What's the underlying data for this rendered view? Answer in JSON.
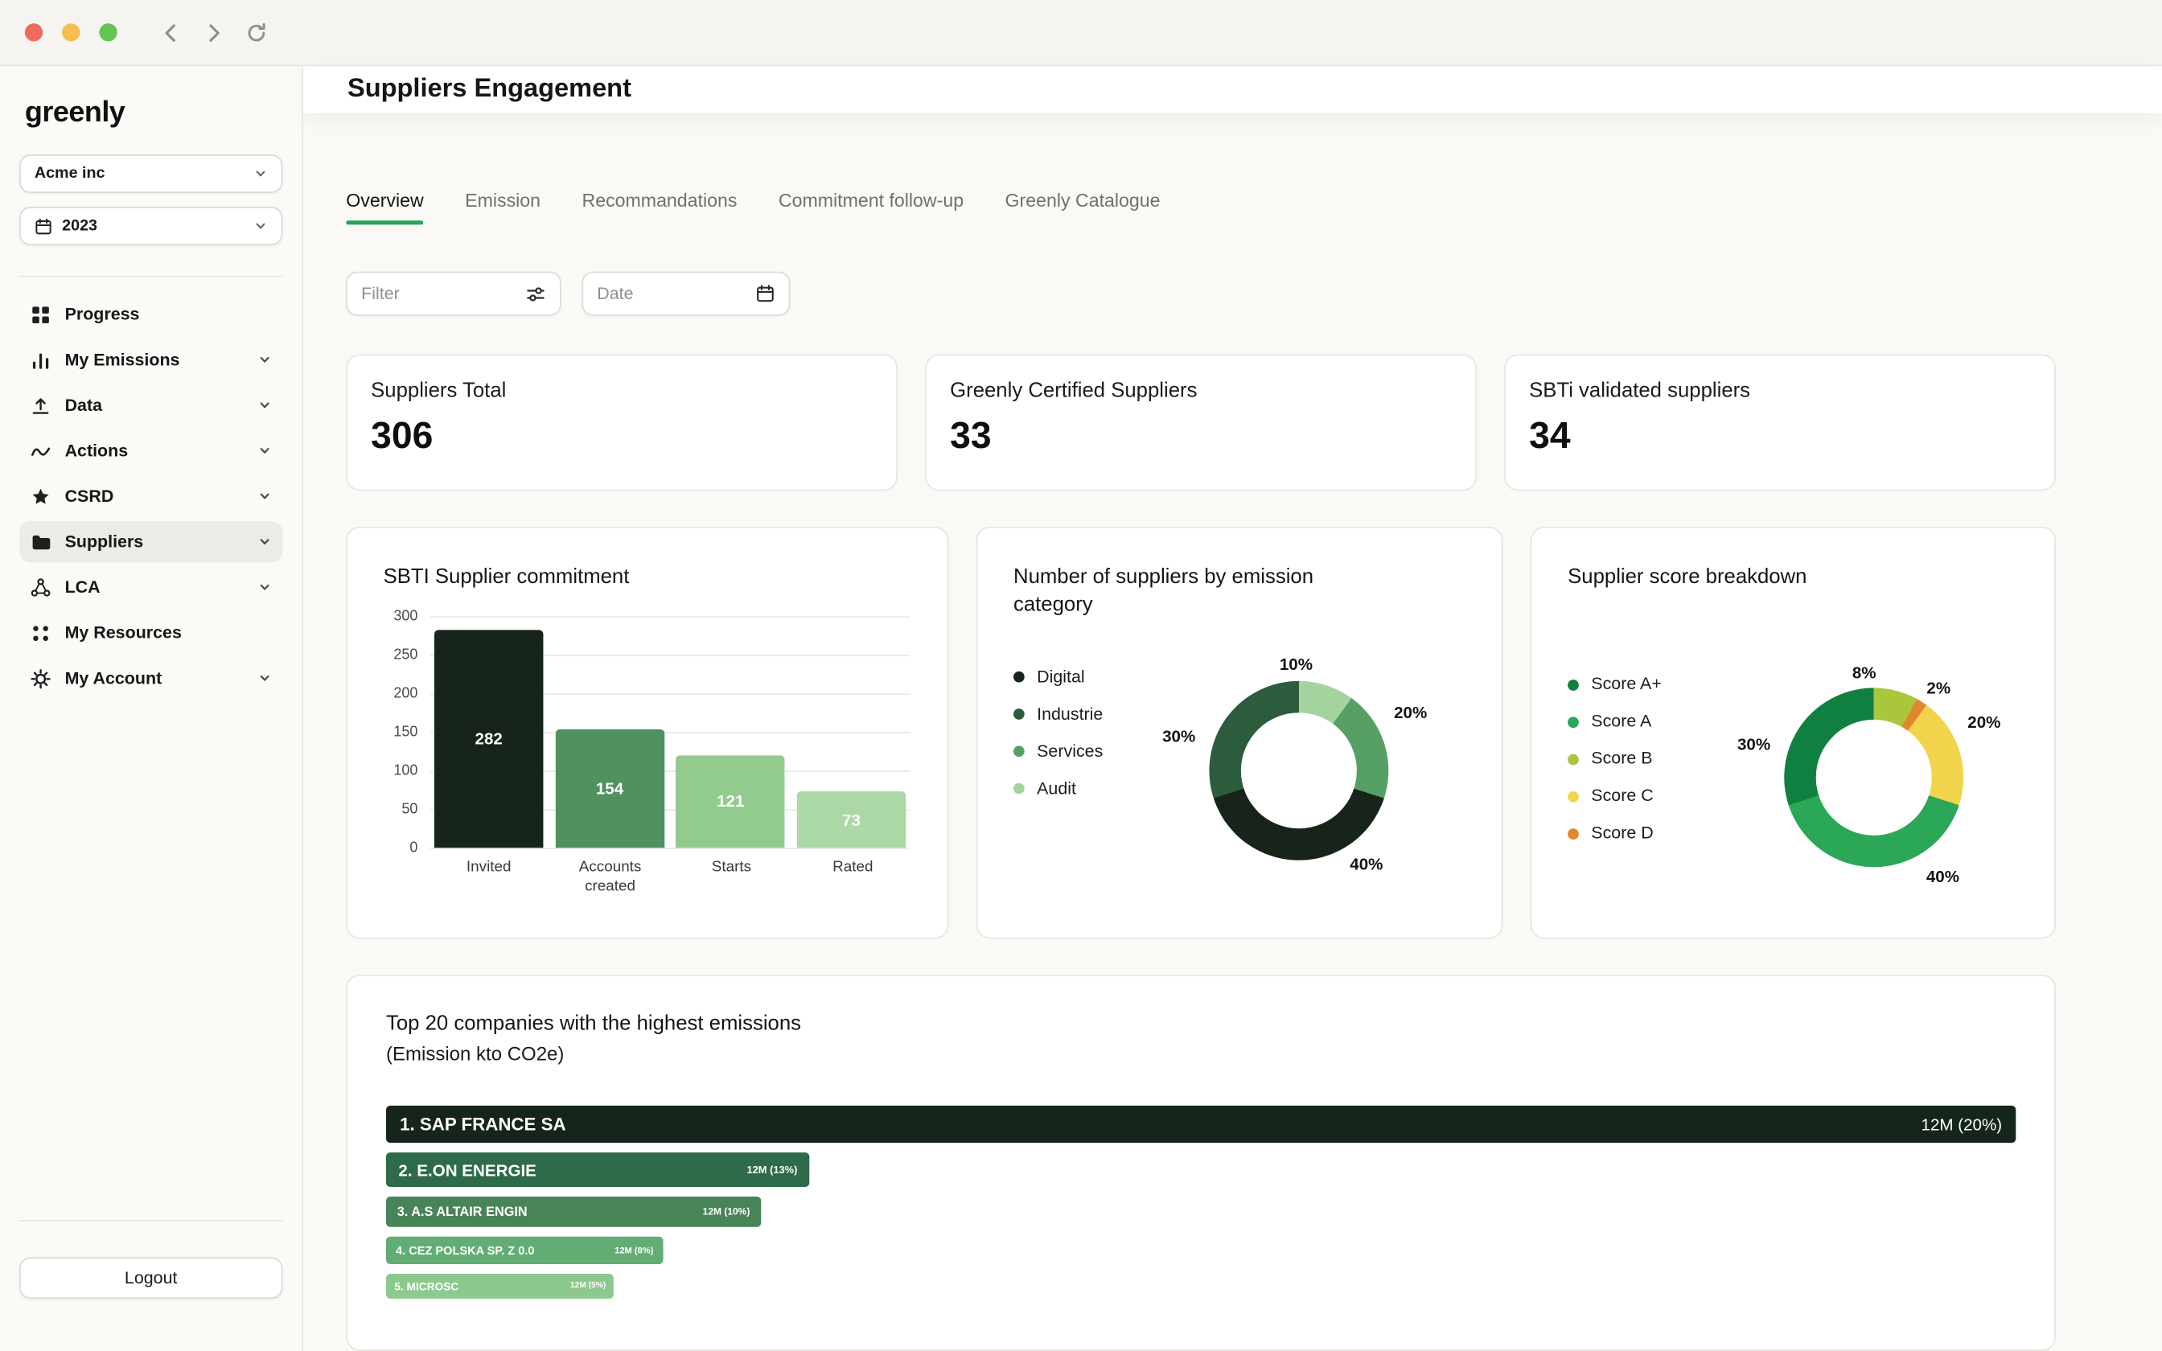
{
  "sidebar": {
    "logo": "greenly",
    "company": "Acme inc",
    "year": "2023",
    "items": [
      {
        "label": "Progress",
        "active": false
      },
      {
        "label": "My Emissions",
        "active": false
      },
      {
        "label": "Data",
        "active": false
      },
      {
        "label": "Actions",
        "active": false
      },
      {
        "label": "CSRD",
        "active": false
      },
      {
        "label": "Suppliers",
        "active": true
      },
      {
        "label": "LCA",
        "active": false
      },
      {
        "label": "My Resources",
        "active": false
      },
      {
        "label": "My Account",
        "active": false
      }
    ],
    "logout": "Logout"
  },
  "header": {
    "title": "Suppliers Engagement"
  },
  "tabs": [
    {
      "label": "Overview",
      "active": true
    },
    {
      "label": "Emission",
      "active": false
    },
    {
      "label": "Recommandations",
      "active": false
    },
    {
      "label": "Commitment follow-up",
      "active": false
    },
    {
      "label": "Greenly Catalogue",
      "active": false
    }
  ],
  "filters": {
    "filter_placeholder": "Filter",
    "date_placeholder": "Date"
  },
  "stats": [
    {
      "label": "Suppliers Total",
      "value": "306"
    },
    {
      "label": "Greenly Certified Suppliers",
      "value": "33"
    },
    {
      "label": "SBTi validated suppliers",
      "value": "34"
    }
  ],
  "chart_data": [
    {
      "id": "sbti-supplier-commitment",
      "type": "bar",
      "title": "SBTI Supplier commitment",
      "categories": [
        "Invited",
        "Accounts created",
        "Starts",
        "Rated"
      ],
      "values": [
        282,
        154,
        121,
        73
      ],
      "bar_colors": [
        "#16241b",
        "#4f9260",
        "#93ca8e",
        "#abd8a6"
      ],
      "ylim": [
        0,
        300
      ],
      "ytick_labels": [
        "300",
        "250",
        "200",
        "150",
        "100",
        "50",
        "0"
      ],
      "grid": true,
      "legend_position": "none"
    },
    {
      "id": "suppliers-by-emission-category",
      "type": "donut",
      "title": "Number of suppliers by emission category",
      "legend_position": "left",
      "legend": [
        {
          "label": "Digital",
          "color": "#182419"
        },
        {
          "label": "Industrie",
          "color": "#2b5d3d"
        },
        {
          "label": "Services",
          "color": "#56a065"
        },
        {
          "label": "Audit",
          "color": "#a5d3a0"
        }
      ],
      "segments": [
        {
          "label": "Audit",
          "pct": 10,
          "pct_label": "10%",
          "color": "#a5d3a0"
        },
        {
          "label": "Services",
          "pct": 20,
          "pct_label": "20%",
          "color": "#56a065"
        },
        {
          "label": "Digital",
          "pct": 40,
          "pct_label": "40%",
          "color": "#182419"
        },
        {
          "label": "Industrie",
          "pct": 30,
          "pct_label": "30%",
          "color": "#2b5d3d"
        }
      ]
    },
    {
      "id": "supplier-score-breakdown",
      "type": "donut",
      "title": "Supplier score breakdown",
      "legend_position": "left",
      "legend": [
        {
          "label": "Score A+",
          "color": "#0f8040"
        },
        {
          "label": "Score A",
          "color": "#2aa757"
        },
        {
          "label": "Score B",
          "color": "#a9c63c"
        },
        {
          "label": "Score C",
          "color": "#f2d44c"
        },
        {
          "label": "Score D",
          "color": "#e2862f"
        }
      ],
      "segments": [
        {
          "label": "Score B",
          "pct": 8,
          "pct_label": "8%",
          "color": "#a9c63c"
        },
        {
          "label": "Score D",
          "pct": 2,
          "pct_label": "2%",
          "color": "#e2862f"
        },
        {
          "label": "Score C",
          "pct": 20,
          "pct_label": "20%",
          "color": "#f2d44c"
        },
        {
          "label": "Score A",
          "pct": 40,
          "pct_label": "40%",
          "color": "#2aa757"
        },
        {
          "label": "Score A+",
          "pct": 30,
          "pct_label": "30%",
          "color": "#0f8040"
        }
      ]
    },
    {
      "id": "top-20-companies",
      "type": "bar",
      "orientation": "horizontal",
      "title": "Top 20 companies with the highest emissions",
      "subtitle": "(Emission kto CO2e)",
      "rows": [
        {
          "rank_label": "1. SAP FRANCE SA",
          "value_label": "12M (20%)",
          "width_pct": 100,
          "color": "#16251c"
        },
        {
          "rank_label": "2. E.ON ENERGIE",
          "value_label": "12M (13%)",
          "width_pct": 26,
          "color": "#2d6b4a"
        },
        {
          "rank_label": "3. A.S ALTAIR ENGIN",
          "value_label": "12M (10%)",
          "width_pct": 23,
          "color": "#478457"
        },
        {
          "rank_label": "4. CEZ POLSKA SP. Z 0.0",
          "value_label": "12M (8%)",
          "width_pct": 17,
          "color": "#63ad74"
        },
        {
          "rank_label": "5. MICROSC",
          "value_label": "12M (5%)",
          "width_pct": 14,
          "color": "#8cc98e"
        }
      ]
    }
  ]
}
